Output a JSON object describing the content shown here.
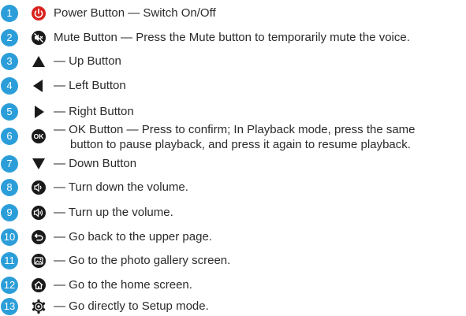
{
  "items": [
    {
      "num": "1",
      "icon": "power-icon",
      "text": "Power Button — Switch On/Off"
    },
    {
      "num": "2",
      "icon": "mute-icon",
      "text": "Mute Button — Press the Mute button to temporarily mute the voice."
    },
    {
      "num": "3",
      "icon": "up-arrow-icon",
      "text": "— Up Button"
    },
    {
      "num": "4",
      "icon": "left-arrow-icon",
      "text": "— Left Button"
    },
    {
      "num": "5",
      "icon": "right-arrow-icon",
      "text": "— Right Button"
    },
    {
      "num": "6",
      "icon": "ok-icon",
      "icon_label": "OK",
      "text": "— OK Button — Press to confirm; In Playback mode, press the same",
      "text2": "button to pause playback, and press it again to resume playback."
    },
    {
      "num": "7",
      "icon": "down-arrow-icon",
      "text": "— Down Button"
    },
    {
      "num": "8",
      "icon": "volume-down-icon",
      "text": "— Turn down the volume."
    },
    {
      "num": "9",
      "icon": "volume-up-icon",
      "text": "— Turn up the volume."
    },
    {
      "num": "10",
      "icon": "back-icon",
      "text": "— Go back to the upper page."
    },
    {
      "num": "11",
      "icon": "gallery-icon",
      "text": "— Go to the photo gallery screen."
    },
    {
      "num": "12",
      "icon": "home-icon",
      "text": "— Go to the home screen."
    },
    {
      "num": "13",
      "icon": "settings-icon",
      "text": "— Go directly to Setup mode."
    }
  ],
  "colors": {
    "badge": "#2b9ed9",
    "power": "#d9221c",
    "icon": "#1a1a1a",
    "text": "#2a2a2a"
  }
}
